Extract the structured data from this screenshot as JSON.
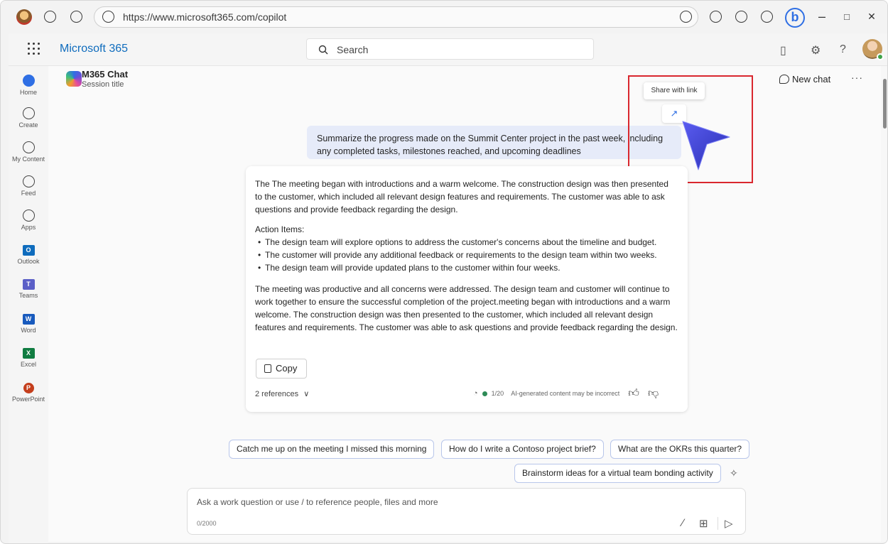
{
  "browser": {
    "url": "https://www.microsoft365.com/copilot",
    "window_controls": [
      "–",
      "□",
      "✕"
    ],
    "bing_label": "b"
  },
  "header": {
    "brand": "Microsoft 365",
    "search_placeholder": "Search"
  },
  "rail": [
    {
      "label": "Home",
      "icon": "home-icon"
    },
    {
      "label": "Create",
      "icon": "create-icon"
    },
    {
      "label": "My Content",
      "icon": "my-content-icon"
    },
    {
      "label": "Feed",
      "icon": "feed-icon"
    },
    {
      "label": "Apps",
      "icon": "apps-icon"
    },
    {
      "label": "Outlook",
      "icon": "outlook-icon",
      "badge": "O",
      "color": "#0f6cbd"
    },
    {
      "label": "Teams",
      "icon": "teams-icon",
      "badge": "T",
      "color": "#5b5fc7"
    },
    {
      "label": "Word",
      "icon": "word-icon",
      "badge": "W",
      "color": "#185abd"
    },
    {
      "label": "Excel",
      "icon": "excel-icon",
      "badge": "X",
      "color": "#107c41"
    },
    {
      "label": "PowerPoint",
      "icon": "powerpoint-icon",
      "badge": "P",
      "color": "#c43e1c"
    }
  ],
  "chat": {
    "title": "M365 Chat",
    "subtitle": "Session title",
    "new_chat": "New chat",
    "more": "···",
    "tooltip": "Share with link",
    "prompt": "Summarize the progress made on the Summit Center project in the past week, including any completed tasks, milestones reached, and upcoming deadlines",
    "response": {
      "intro": "The The meeting began with introductions and a warm welcome. The construction design was then presented to the customer, which included all relevant design features and requirements. The customer was able to ask questions and provide feedback regarding the design.",
      "action_heading": "Action Items:",
      "action_items": [
        "The design team will explore options to address the customer's concerns about the timeline and budget.",
        "The customer will provide any additional feedback or requirements to the design team within two weeks.",
        "The design team will provide updated plans to the customer within four weeks."
      ],
      "closing": "The meeting was productive and all concerns were addressed. The design team and customer will continue to work together to ensure the successful completion of the project.meeting began with introductions and a warm welcome. The construction design was then presented to the customer, which included all relevant design features and requirements. The customer was able to ask questions and provide feedback regarding the design.",
      "copy_label": "Copy",
      "references": "2 references",
      "counter": "1/20",
      "disclaimer": "AI-generated content may be incorrect"
    }
  },
  "suggestions": [
    "Catch me up on the meeting I missed this morning",
    "How do I write a Contoso project brief?",
    "What are the OKRs this quarter?",
    "Brainstorm ideas for a virtual team bonding activity"
  ],
  "composer": {
    "placeholder": "Ask a work question or use / to reference people, files and more",
    "count": "0/2000"
  }
}
